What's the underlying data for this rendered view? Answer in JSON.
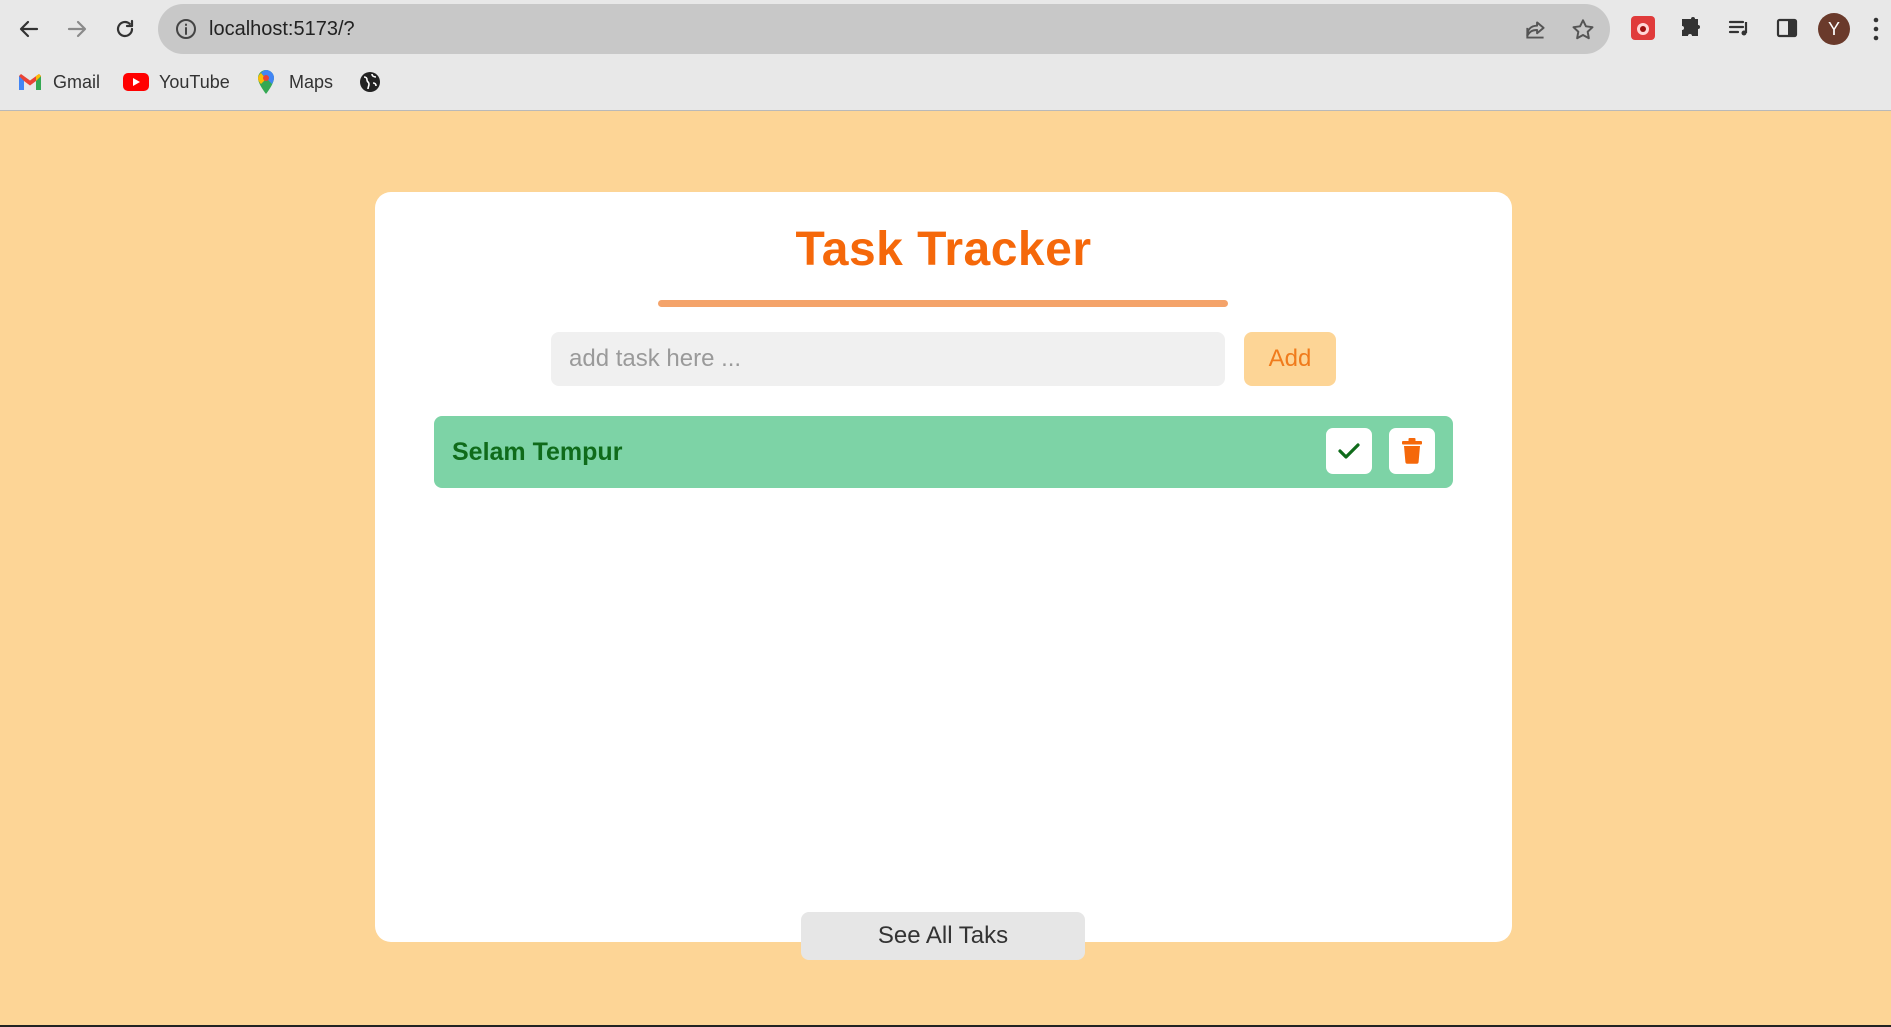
{
  "browser": {
    "url": "localhost:5173/?",
    "avatar_letter": "Y",
    "bookmarks": [
      {
        "label": "Gmail",
        "icon": "gmail-icon"
      },
      {
        "label": "YouTube",
        "icon": "youtube-icon"
      },
      {
        "label": "Maps",
        "icon": "maps-icon"
      },
      {
        "label": "",
        "icon": "globe-icon"
      }
    ]
  },
  "app": {
    "title": "Task Tracker",
    "input": {
      "value": "",
      "placeholder": "add task here ..."
    },
    "add_label": "Add",
    "tasks": [
      {
        "text": "Selam Tempur"
      }
    ],
    "see_all_label": "See All Taks"
  },
  "colors": {
    "page_bg": "#fdd596",
    "accent": "#f5680a",
    "task_bg": "#7dd3a6",
    "task_text": "#0f6b1a"
  }
}
